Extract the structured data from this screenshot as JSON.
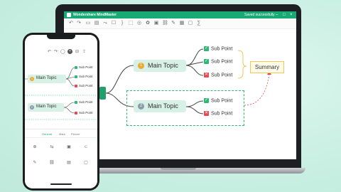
{
  "desktop": {
    "app_name": "Wondershare MindMaster",
    "save_label": "Saved successfully",
    "window_controls": [
      "–",
      "□",
      "×"
    ],
    "main_topics": [
      {
        "number": "1",
        "label": "Main Topic",
        "badge_color": "#f0a92e"
      },
      {
        "number": "2",
        "label": "Main Topic",
        "badge_color": "#8a9aa7"
      }
    ],
    "sub_points_1": [
      {
        "label": "Sub Point",
        "status": "ok"
      },
      {
        "label": "Sub Point",
        "status": "ok"
      },
      {
        "label": "Sub Point",
        "status": "no"
      }
    ],
    "sub_points_2": [
      {
        "label": "Sub Point",
        "status": "ok"
      },
      {
        "label": "Sub Point",
        "status": "no"
      }
    ],
    "summary_label": "Summary"
  },
  "mobile": {
    "main_topics": [
      {
        "number": "1",
        "label": "Main Topic",
        "badge_color": "#f0a92e"
      },
      {
        "number": "2",
        "label": "Main Topic",
        "badge_color": "#8a9aa7"
      }
    ],
    "sub_points_1": [
      "Sub Point",
      "Sub Point",
      "Sub Point"
    ],
    "sub_points_2": [
      "Sub Point",
      "Sub Point"
    ],
    "panel_tabs": [
      "General",
      "Mark",
      "Picture"
    ]
  },
  "colors": {
    "accent": "#19a974",
    "ok": "#2eb872",
    "no": "#e8474f",
    "summary_border": "#f1c75b"
  }
}
